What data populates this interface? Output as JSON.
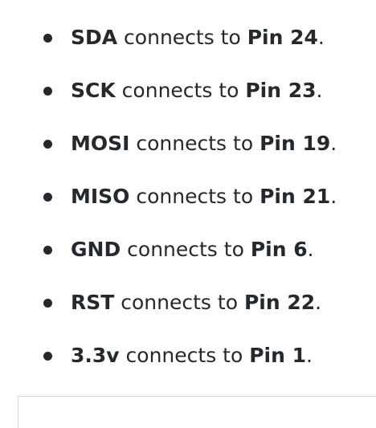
{
  "items": [
    {
      "signal": "SDA",
      "text": " connects to ",
      "pin": "Pin 24",
      "end": "."
    },
    {
      "signal": "SCK",
      "text": " connects to ",
      "pin": "Pin 23",
      "end": "."
    },
    {
      "signal": "MOSI",
      "text": " connects to ",
      "pin": "Pin 19",
      "end": "."
    },
    {
      "signal": "MISO",
      "text": " connects to ",
      "pin": "Pin 21",
      "end": "."
    },
    {
      "signal": "GND",
      "text": " connects to ",
      "pin": "Pin 6",
      "end": "."
    },
    {
      "signal": "RST",
      "text": " connects to ",
      "pin": "Pin 22",
      "end": "."
    },
    {
      "signal": "3.3v",
      "text": " connects to ",
      "pin": "Pin 1",
      "end": "."
    }
  ]
}
